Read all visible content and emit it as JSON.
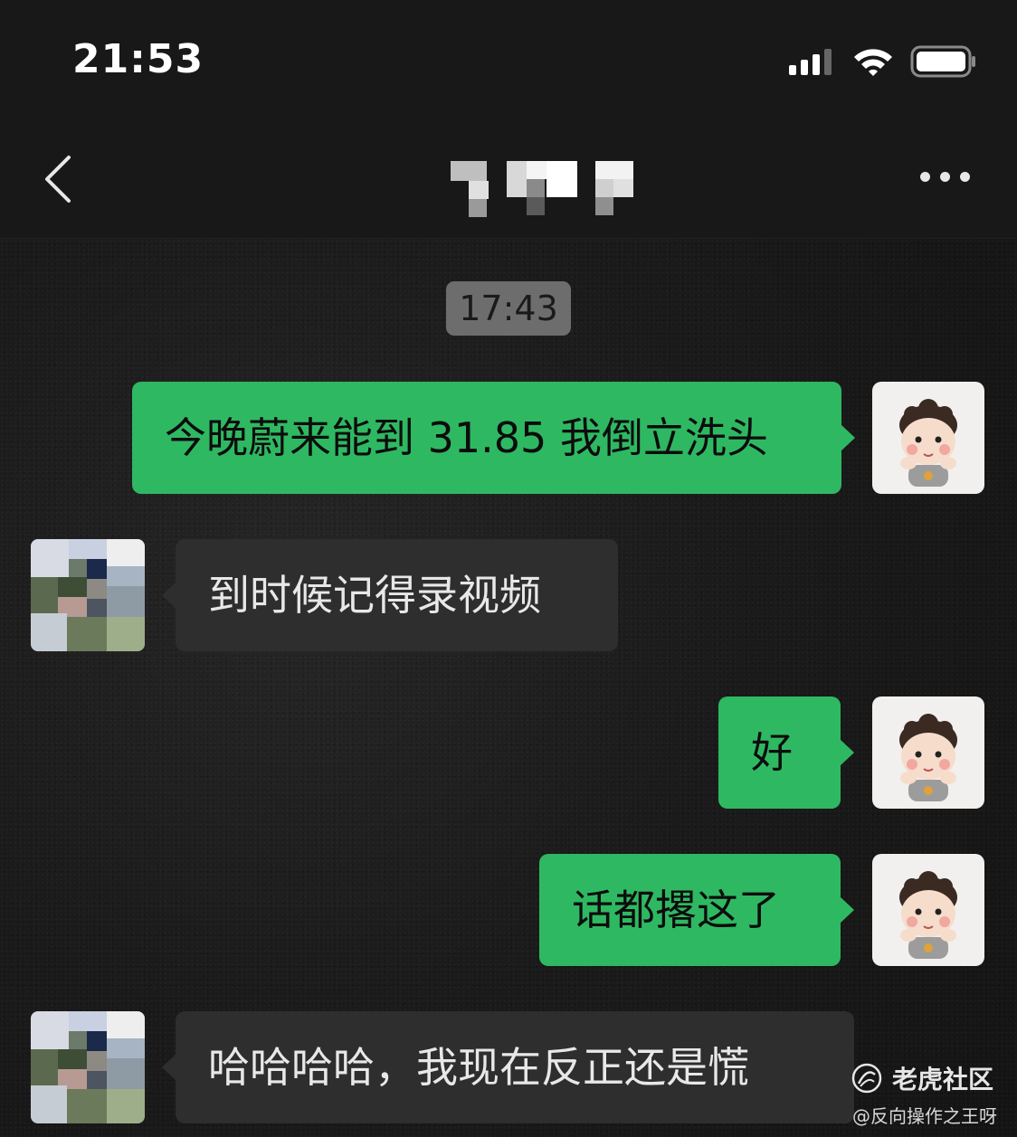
{
  "status_bar": {
    "time": "21:53"
  },
  "nav": {
    "back_icon": "chevron-left-icon",
    "more_icon": "more-dots-icon",
    "title_obscured": true
  },
  "chat": {
    "timestamp": "17:43",
    "messages": [
      {
        "direction": "outgoing",
        "text": "今晚蔚来能到 31.85 我倒立洗头"
      },
      {
        "direction": "incoming",
        "text": "到时候记得录视频"
      },
      {
        "direction": "outgoing",
        "text": "好"
      },
      {
        "direction": "outgoing",
        "text": "话都撂这了"
      },
      {
        "direction": "incoming",
        "text": "哈哈哈哈，我现在反正还是慌"
      }
    ]
  },
  "watermark": {
    "brand": "老虎社区",
    "user": "@反向操作之王呀"
  },
  "colors": {
    "outgoing_bubble": "#2fb862",
    "incoming_bubble": "#2e2e2e",
    "background": "#181818"
  }
}
